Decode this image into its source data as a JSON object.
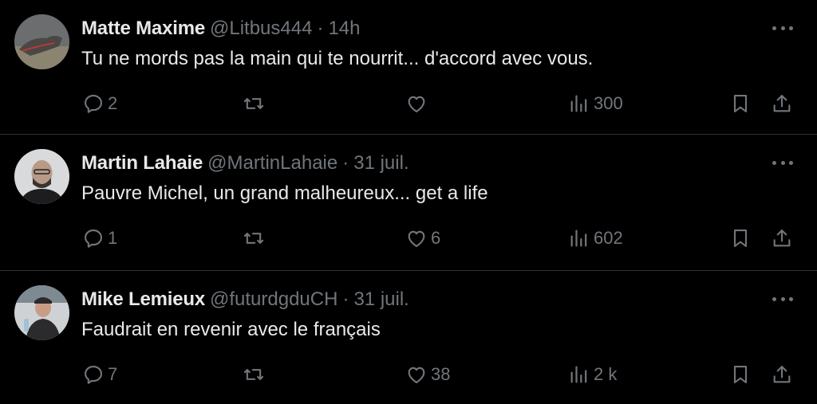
{
  "tweets": [
    {
      "name": "Matte Maxime",
      "handle": "@Litbus444",
      "separator": "·",
      "time": "14h",
      "text": "Tu ne mords pas la main qui te nourrit... d'accord avec vous.",
      "replies": "2",
      "retweets": "",
      "likes": "",
      "views": "300"
    },
    {
      "name": "Martin Lahaie",
      "handle": "@MartinLahaie",
      "separator": "·",
      "time": "31 juil.",
      "text": "Pauvre Michel, un grand malheureux... get a life",
      "replies": "1",
      "retweets": "",
      "likes": "6",
      "views": "602"
    },
    {
      "name": "Mike Lemieux",
      "handle": "@futurdgduCH",
      "separator": "·",
      "time": "31 juil.",
      "text": "Faudrait en revenir avec le français",
      "replies": "7",
      "retweets": "",
      "likes": "38",
      "views": "2 k"
    }
  ],
  "icons": {
    "reply": "reply-icon",
    "retweet": "retweet-icon",
    "like": "heart-icon",
    "views": "views-icon",
    "bookmark": "bookmark-icon",
    "share": "share-icon",
    "more": "more-icon"
  },
  "colors": {
    "background": "#000000",
    "primary_text": "#e7e9ea",
    "secondary_text": "#71767b",
    "divider": "#2f3336"
  }
}
